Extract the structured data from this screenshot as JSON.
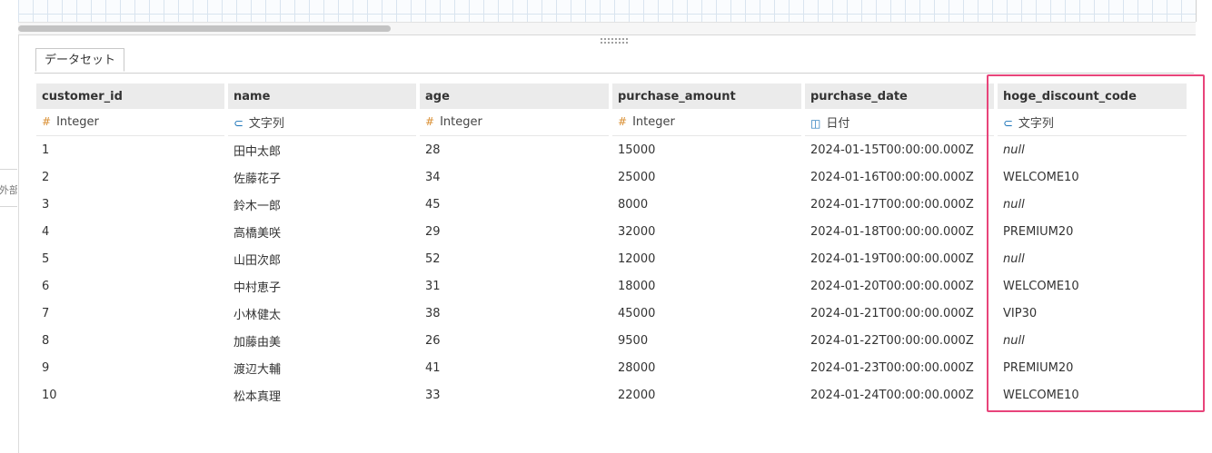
{
  "sidebar": {
    "truncated_label": "外部"
  },
  "tabs": [
    {
      "label": "データセット"
    }
  ],
  "columns": [
    {
      "name": "customer_id",
      "type_icon": "hash-icon",
      "type_label": "Integer"
    },
    {
      "name": "name",
      "type_icon": "tag-icon",
      "type_label": "文字列"
    },
    {
      "name": "age",
      "type_icon": "hash-icon",
      "type_label": "Integer"
    },
    {
      "name": "purchase_amount",
      "type_icon": "hash-icon",
      "type_label": "Integer"
    },
    {
      "name": "purchase_date",
      "type_icon": "calendar-icon",
      "type_label": "日付"
    },
    {
      "name": "hoge_discount_code",
      "type_icon": "tag-icon",
      "type_label": "文字列"
    }
  ],
  "rows": [
    [
      "1",
      "田中太郎",
      "28",
      "15000",
      "2024-01-15T00:00:00.000Z",
      "null"
    ],
    [
      "2",
      "佐藤花子",
      "34",
      "25000",
      "2024-01-16T00:00:00.000Z",
      "WELCOME10"
    ],
    [
      "3",
      "鈴木一郎",
      "45",
      "8000",
      "2024-01-17T00:00:00.000Z",
      "null"
    ],
    [
      "4",
      "高橋美咲",
      "29",
      "32000",
      "2024-01-18T00:00:00.000Z",
      "PREMIUM20"
    ],
    [
      "5",
      "山田次郎",
      "52",
      "12000",
      "2024-01-19T00:00:00.000Z",
      "null"
    ],
    [
      "6",
      "中村恵子",
      "31",
      "18000",
      "2024-01-20T00:00:00.000Z",
      "WELCOME10"
    ],
    [
      "7",
      "小林健太",
      "38",
      "45000",
      "2024-01-21T00:00:00.000Z",
      "VIP30"
    ],
    [
      "8",
      "加藤由美",
      "26",
      "9500",
      "2024-01-22T00:00:00.000Z",
      "null"
    ],
    [
      "9",
      "渡辺大輔",
      "41",
      "28000",
      "2024-01-23T00:00:00.000Z",
      "PREMIUM20"
    ],
    [
      "10",
      "松本真理",
      "33",
      "22000",
      "2024-01-24T00:00:00.000Z",
      "WELCOME10"
    ]
  ],
  "colors": {
    "highlight": "#e8447a",
    "number_icon": "#d98d2f",
    "string_icon": "#1a73b8"
  }
}
